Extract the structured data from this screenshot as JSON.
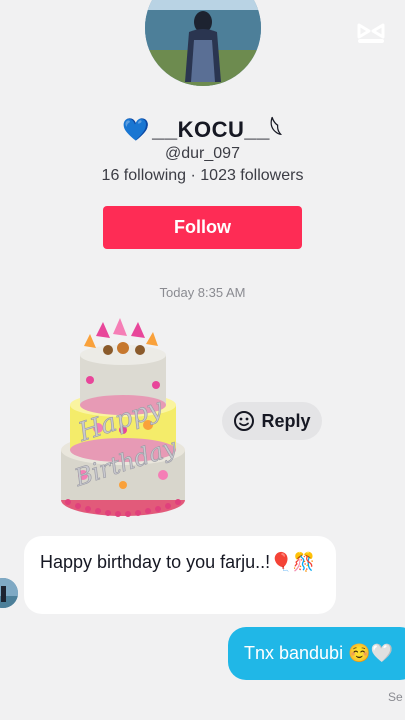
{
  "profile": {
    "display_name_prefix": "💙",
    "display_name": "__KOCU__𓆩",
    "handle": "@dur_097",
    "stats": "16 following · 1023 followers",
    "follow_label": "Follow"
  },
  "chat": {
    "timestamp": "Today 8:35 AM",
    "reply_label": "Reply",
    "incoming_message": "Happy birthday to you farju..!🎈🎊",
    "outgoing_message": "Tnx bandubi ☺️🤍",
    "seen_label": "Se"
  },
  "colors": {
    "follow_button": "#fe2c55",
    "outgoing_bubble": "#20b7e7",
    "background": "#f1f1f2"
  },
  "icons": [
    "capcut-logo-icon",
    "emoji-reply-icon",
    "birthday-cake-sticker"
  ]
}
